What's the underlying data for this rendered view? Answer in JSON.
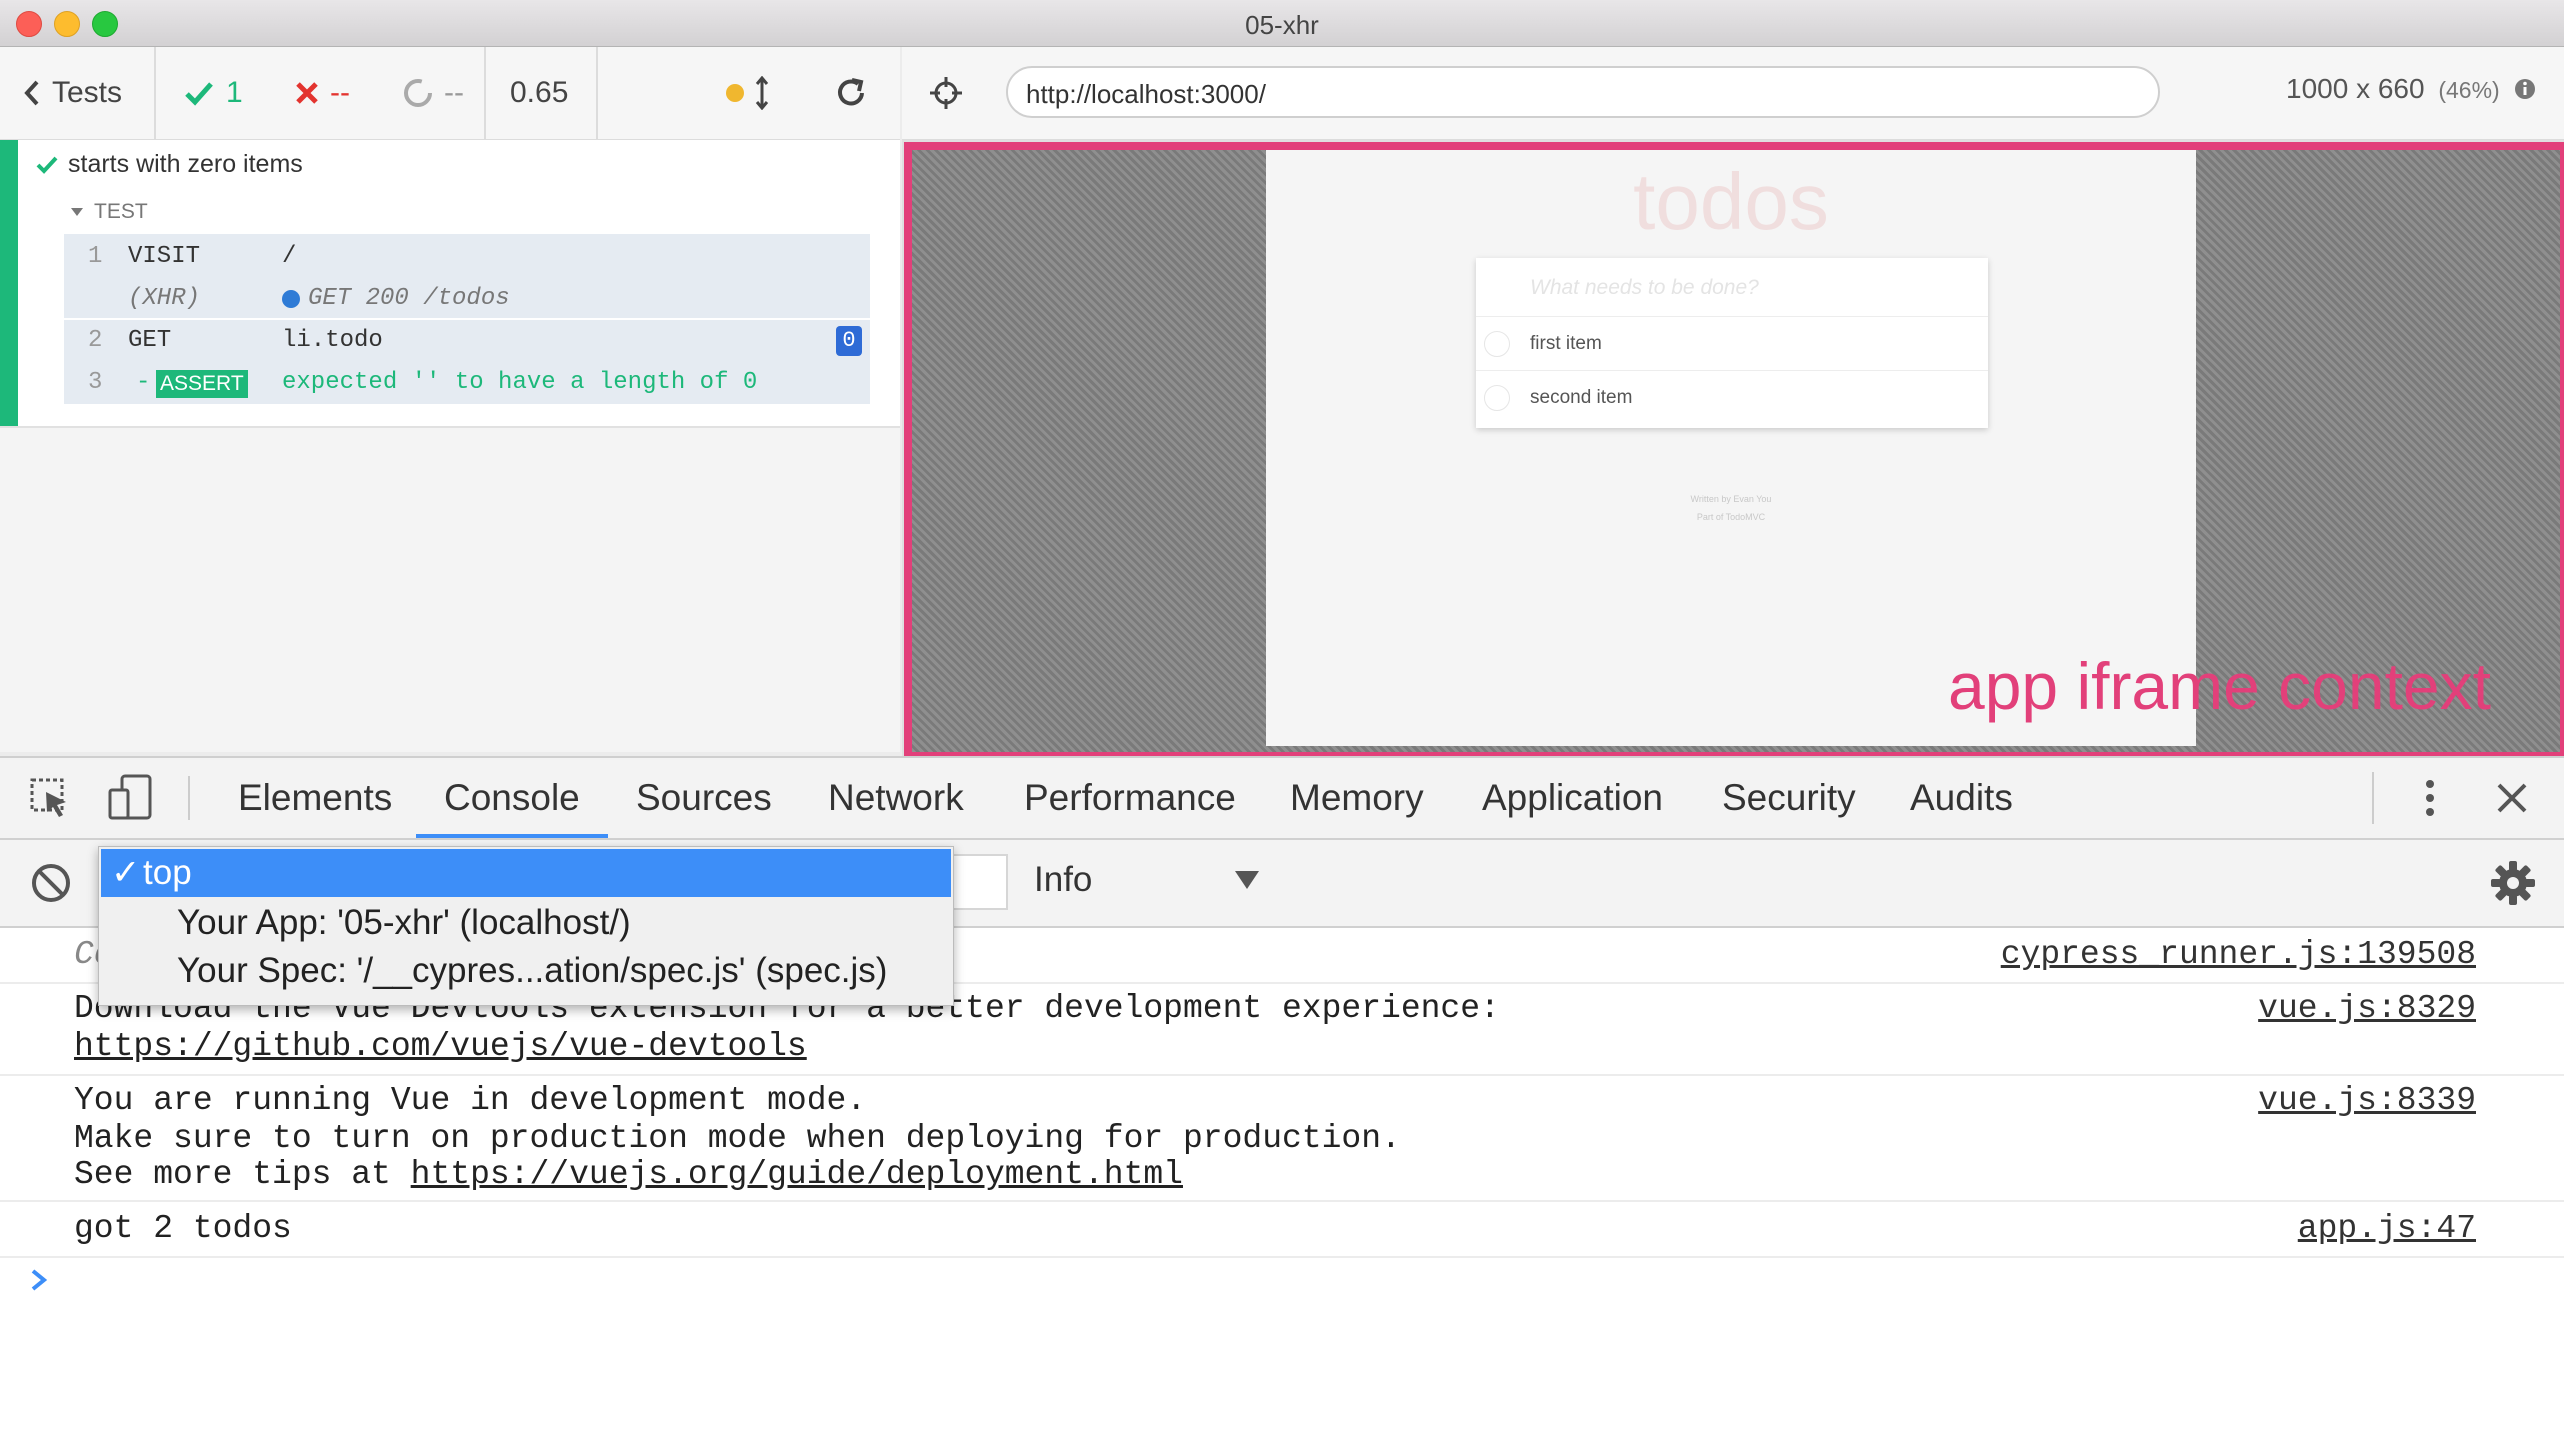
{
  "window": {
    "title": "05-xhr"
  },
  "runner": {
    "back_label": "Tests",
    "passed_count": "1",
    "failed_count": "--",
    "pending_count": "--",
    "duration": "0.65",
    "url": "http://localhost:3000/",
    "viewport": "1000 x 660",
    "scale": "(46%)"
  },
  "reporter": {
    "test_title": "starts with zero items",
    "section_label": "TEST",
    "commands": [
      {
        "num": "1",
        "name": "VISIT",
        "message": "/"
      },
      {
        "num": "",
        "name": "(XHR)",
        "message": "GET 200 /todos"
      },
      {
        "num": "2",
        "name": "GET",
        "message": "li.todo",
        "badge": "0"
      },
      {
        "num": "3",
        "name": "ASSERT",
        "prefix": "-",
        "message_parts": [
          "expected",
          "''",
          "to have a length of",
          "0"
        ]
      }
    ]
  },
  "app": {
    "heading": "todos",
    "input_placeholder": "What needs to be done?",
    "items": [
      "first item",
      "second item"
    ],
    "footer_lines": [
      "Written by Evan You",
      "Part of TodoMVC"
    ],
    "context_label": "app iframe context"
  },
  "devtools": {
    "tabs": [
      "Elements",
      "Console",
      "Sources",
      "Network",
      "Performance",
      "Memory",
      "Application",
      "Security",
      "Audits"
    ],
    "active_tab": "Console",
    "level": "Info",
    "context_menu": {
      "selected": "top",
      "options": [
        "Your App: '05-xhr' (localhost/)",
        "Your Spec: '/__cypres...ation/spec.js' (spec.js)"
      ]
    },
    "console": [
      {
        "text": "Co",
        "source": "cypress_runner.js:139508"
      },
      {
        "line1": "Download the Vue Devtools extension for a better development experience:",
        "link": "https://github.com/vuejs/vue-devtools",
        "source": "vue.js:8329"
      },
      {
        "line1": "You are running Vue in development mode.",
        "line2": "Make sure to turn on production mode when deploying for production.",
        "line3_prefix": "See more tips at ",
        "link": "https://vuejs.org/guide/deployment.html",
        "source": "vue.js:8339"
      },
      {
        "text": "got 2 todos",
        "source": "app.js:47"
      }
    ],
    "prompt": ">"
  },
  "colors": {
    "pass": "#1db87a",
    "fail": "#e3342f",
    "aut_border": "#e2407a",
    "selected_blue": "#3d8ef8"
  }
}
